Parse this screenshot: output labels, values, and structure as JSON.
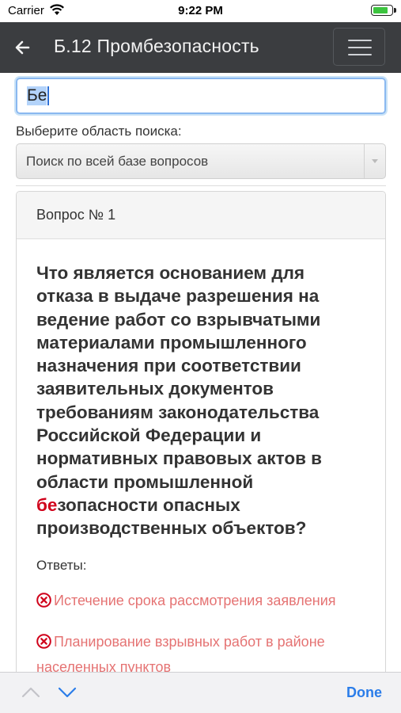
{
  "status_bar": {
    "carrier": "Carrier",
    "time": "9:22 PM",
    "battery_level": 0.8,
    "battery_color": "#3cc43f",
    "wifi_icon": "wifi-icon"
  },
  "navbar": {
    "title": "Б.12 Промбезопасность",
    "back_icon": "back-arrow-icon",
    "menu_icon": "hamburger-menu-icon",
    "background": "#3b3d40"
  },
  "search": {
    "value": "Бе",
    "scope_label": "Выберите область поиска:",
    "scope_selected": "Поиск по всей базе вопросов"
  },
  "question": {
    "header": "Вопрос № 1",
    "text_before": "Что является основанием для отказа в выдаче разрешения на ведение работ со взрывчатыми материалами промышленного назначения при соответствии заявительных документов требованиям законодательства Российской Федерации и нормативных правовых актов в области промышленной ",
    "text_highlight": "бе",
    "text_after": "зопасности опасных производственных объектов?",
    "highlight_color": "#d0021b",
    "answers_label": "Ответы:",
    "answers": [
      {
        "text": "Истечение срока рассмотрения заявления",
        "status": "wrong",
        "icon": "wrong-x-icon"
      },
      {
        "text": "Планирование взрывных работ в районе населенных пунктов",
        "status": "wrong",
        "icon": "wrong-x-icon"
      }
    ],
    "wrong_color": "#e57373"
  },
  "keyboard_accessory": {
    "prev_icon": "chevron-up-icon",
    "next_icon": "chevron-down-icon",
    "done_label": "Done",
    "done_color": "#2b7de9"
  }
}
